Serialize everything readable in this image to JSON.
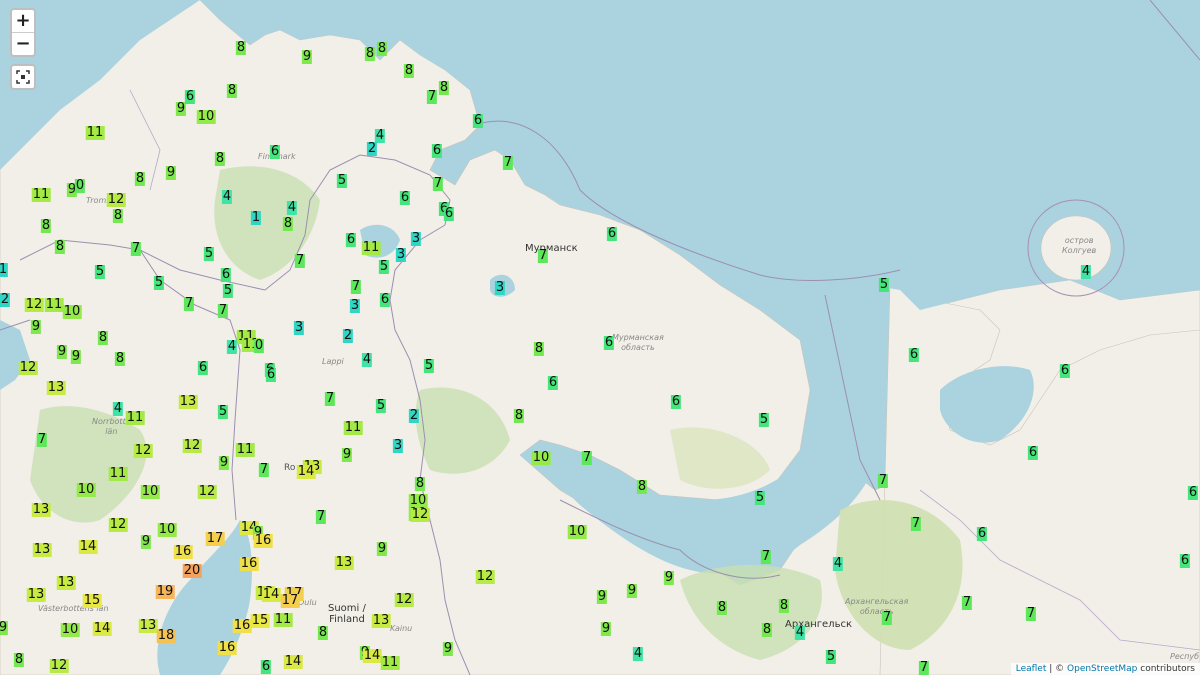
{
  "controls": {
    "zoom_in": "+",
    "zoom_out": "−"
  },
  "place_labels": {
    "murmansk": "Мурманск",
    "arkhangelsk": "Архангельск",
    "kolguev": "остров\nКолгуев",
    "murmansk_oblast": "Мурманская\nобласть",
    "arkhangelsk_oblast": "Архангельская\nобласть",
    "lappi": "Lappi",
    "suomi": "Suomi /\nFinland",
    "norrbotten": "Norrbotte\nlän",
    "vasterbotten": "Västerbottens\nlän",
    "finnmark": "Finnmark",
    "tromso": "Troms",
    "rovaniemi": "Ro",
    "oulu": "Oulu",
    "kainuu": "Kainu",
    "respublika": "Респуб"
  },
  "attribution": {
    "leaflet": "Leaflet",
    "sep": " | © ",
    "osm": "OpenStreetMap",
    "tail": " contributors"
  },
  "marker_colors": {
    "1": "#2fd6c4",
    "2": "#2fd6c4",
    "3": "#2fd6c4",
    "4": "#3fe3a6",
    "5": "#44e57a",
    "6": "#44e57a",
    "7": "#5ce85a",
    "8": "#74e84f",
    "9": "#7ee84c",
    "10": "#93ea49",
    "11": "#a4ea47",
    "12": "#b6ea45",
    "13": "#c8eb44",
    "14": "#dbe944",
    "15": "#e8e844",
    "16": "#efe04a",
    "17": "#f3cf4d",
    "18": "#f6c153",
    "19": "#f7b458",
    "20": "#f5a35c"
  },
  "markers": [
    [
      "8",
      241,
      48
    ],
    [
      "9",
      307,
      57
    ],
    [
      "8",
      370,
      54
    ],
    [
      "8",
      382,
      49
    ],
    [
      "8",
      409,
      71
    ],
    [
      "8",
      444,
      88
    ],
    [
      "7",
      432,
      97
    ],
    [
      "6",
      478,
      121
    ],
    [
      "9",
      181,
      109
    ],
    [
      "6",
      190,
      97
    ],
    [
      "8",
      232,
      91
    ],
    [
      "10",
      206,
      117
    ],
    [
      "11",
      95,
      133
    ],
    [
      "6",
      275,
      152
    ],
    [
      "8",
      220,
      159
    ],
    [
      "4",
      380,
      136
    ],
    [
      "2",
      372,
      149
    ],
    [
      "6",
      437,
      151
    ],
    [
      "9",
      171,
      173
    ],
    [
      "8",
      140,
      179
    ],
    [
      "9",
      72,
      190
    ],
    [
      "0",
      80,
      186
    ],
    [
      "11",
      41,
      195
    ],
    [
      "12",
      116,
      200
    ],
    [
      "8",
      118,
      216
    ],
    [
      "8",
      46,
      226
    ],
    [
      "8",
      60,
      247
    ],
    [
      "7",
      136,
      249
    ],
    [
      "5",
      100,
      272
    ],
    [
      "1",
      3,
      270
    ],
    [
      "4",
      227,
      197
    ],
    [
      "1",
      256,
      218
    ],
    [
      "4",
      292,
      208
    ],
    [
      "8",
      288,
      224
    ],
    [
      "5",
      342,
      181
    ],
    [
      "6",
      405,
      198
    ],
    [
      "7",
      438,
      184
    ],
    [
      "6",
      444,
      209
    ],
    [
      "6",
      449,
      214
    ],
    [
      "7",
      508,
      163
    ],
    [
      "5",
      209,
      254
    ],
    [
      "7",
      300,
      261
    ],
    [
      "6",
      351,
      240
    ],
    [
      "11",
      371,
      248
    ],
    [
      "3",
      416,
      239
    ],
    [
      "5",
      384,
      267
    ],
    [
      "3",
      401,
      255
    ],
    [
      "6",
      612,
      234
    ],
    [
      "7",
      543,
      256
    ],
    [
      "6",
      226,
      275
    ],
    [
      "5",
      228,
      291
    ],
    [
      "5",
      159,
      283
    ],
    [
      "7",
      356,
      287
    ],
    [
      "6",
      385,
      300
    ],
    [
      "3",
      355,
      306
    ],
    [
      "3",
      500,
      288
    ],
    [
      "2",
      5,
      300
    ],
    [
      "12",
      34,
      305
    ],
    [
      "11",
      54,
      305
    ],
    [
      "10",
      72,
      312
    ],
    [
      "7",
      189,
      304
    ],
    [
      "7",
      223,
      311
    ],
    [
      "9",
      36,
      327
    ],
    [
      "8",
      103,
      338
    ],
    [
      "3",
      299,
      328
    ],
    [
      "2",
      348,
      336
    ],
    [
      "11",
      246,
      337
    ],
    [
      "11",
      251,
      345
    ],
    [
      "0",
      259,
      346
    ],
    [
      "4",
      232,
      347
    ],
    [
      "9",
      62,
      352
    ],
    [
      "9",
      76,
      357
    ],
    [
      "8",
      120,
      359
    ],
    [
      "4",
      367,
      360
    ],
    [
      "5",
      429,
      366
    ],
    [
      "6",
      609,
      343
    ],
    [
      "8",
      539,
      349
    ],
    [
      "12",
      28,
      368
    ],
    [
      "6",
      203,
      368
    ],
    [
      "6",
      270,
      370
    ],
    [
      "6",
      271,
      375
    ],
    [
      "6",
      553,
      383
    ],
    [
      "13",
      56,
      388
    ],
    [
      "7",
      330,
      399
    ],
    [
      "5",
      381,
      406
    ],
    [
      "6",
      676,
      402
    ],
    [
      "4",
      118,
      409
    ],
    [
      "11",
      135,
      418
    ],
    [
      "13",
      188,
      402
    ],
    [
      "5",
      223,
      412
    ],
    [
      "2",
      414,
      416
    ],
    [
      "8",
      519,
      416
    ],
    [
      "5",
      764,
      420
    ],
    [
      "7",
      42,
      440
    ],
    [
      "11",
      353,
      428
    ],
    [
      "3",
      398,
      446
    ],
    [
      "12",
      143,
      451
    ],
    [
      "12",
      192,
      446
    ],
    [
      "11",
      245,
      450
    ],
    [
      "9",
      347,
      455
    ],
    [
      "9",
      224,
      463
    ],
    [
      "7",
      264,
      470
    ],
    [
      "13",
      312,
      467
    ],
    [
      "14",
      306,
      472
    ],
    [
      "10",
      541,
      458
    ],
    [
      "7",
      587,
      458
    ],
    [
      "11",
      118,
      474
    ],
    [
      "8",
      420,
      484
    ],
    [
      "10",
      86,
      490
    ],
    [
      "10",
      150,
      492
    ],
    [
      "12",
      207,
      492
    ],
    [
      "8",
      642,
      487
    ],
    [
      "5",
      760,
      498
    ],
    [
      "10",
      418,
      501
    ],
    [
      "10",
      418,
      514
    ],
    [
      "12",
      420,
      515
    ],
    [
      "13",
      41,
      510
    ],
    [
      "7",
      321,
      517
    ],
    [
      "12",
      118,
      525
    ],
    [
      "10",
      167,
      530
    ],
    [
      "14",
      249,
      528
    ],
    [
      "9",
      258,
      533
    ],
    [
      "9",
      146,
      542
    ],
    [
      "17",
      215,
      539
    ],
    [
      "16",
      263,
      541
    ],
    [
      "10",
      577,
      532
    ],
    [
      "13",
      42,
      550
    ],
    [
      "14",
      88,
      547
    ],
    [
      "16",
      183,
      552
    ],
    [
      "9",
      382,
      549
    ],
    [
      "20",
      192,
      571
    ],
    [
      "16",
      249,
      564
    ],
    [
      "13",
      344,
      563
    ],
    [
      "12",
      485,
      577
    ],
    [
      "9",
      669,
      578
    ],
    [
      "7",
      766,
      557
    ],
    [
      "4",
      838,
      564
    ],
    [
      "13",
      66,
      583
    ],
    [
      "13",
      36,
      595
    ],
    [
      "15",
      92,
      601
    ],
    [
      "19",
      165,
      592
    ],
    [
      "13",
      265,
      593
    ],
    [
      "14",
      271,
      595
    ],
    [
      "17",
      294,
      594
    ],
    [
      "17",
      290,
      601
    ],
    [
      "12",
      404,
      600
    ],
    [
      "9",
      602,
      597
    ],
    [
      "9",
      632,
      591
    ],
    [
      "8",
      722,
      608
    ],
    [
      "8",
      784,
      606
    ],
    [
      "7",
      887,
      618
    ],
    [
      "7",
      967,
      603
    ],
    [
      "7",
      1031,
      614
    ],
    [
      "9",
      3,
      628
    ],
    [
      "10",
      70,
      630
    ],
    [
      "14",
      102,
      629
    ],
    [
      "13",
      148,
      626
    ],
    [
      "18",
      166,
      636
    ],
    [
      "16",
      242,
      626
    ],
    [
      "15",
      260,
      621
    ],
    [
      "11",
      283,
      620
    ],
    [
      "8",
      323,
      633
    ],
    [
      "13",
      381,
      621
    ],
    [
      "9",
      606,
      629
    ],
    [
      "8",
      767,
      630
    ],
    [
      "4",
      800,
      633
    ],
    [
      "8",
      19,
      660
    ],
    [
      "12",
      59,
      666
    ],
    [
      "16",
      227,
      648
    ],
    [
      "6",
      266,
      667
    ],
    [
      "14",
      293,
      662
    ],
    [
      "9",
      365,
      653
    ],
    [
      "14",
      372,
      656
    ],
    [
      "11",
      390,
      663
    ],
    [
      "9",
      448,
      649
    ],
    [
      "4",
      638,
      654
    ],
    [
      "5",
      831,
      657
    ],
    [
      "7",
      924,
      668
    ],
    [
      "5",
      884,
      285
    ],
    [
      "6",
      914,
      355
    ],
    [
      "4",
      1086,
      272
    ],
    [
      "6",
      1065,
      371
    ],
    [
      "6",
      1033,
      453
    ],
    [
      "7",
      883,
      481
    ],
    [
      "7",
      916,
      524
    ],
    [
      "6",
      982,
      534
    ],
    [
      "6",
      1193,
      493
    ],
    [
      "6",
      1185,
      561
    ]
  ]
}
